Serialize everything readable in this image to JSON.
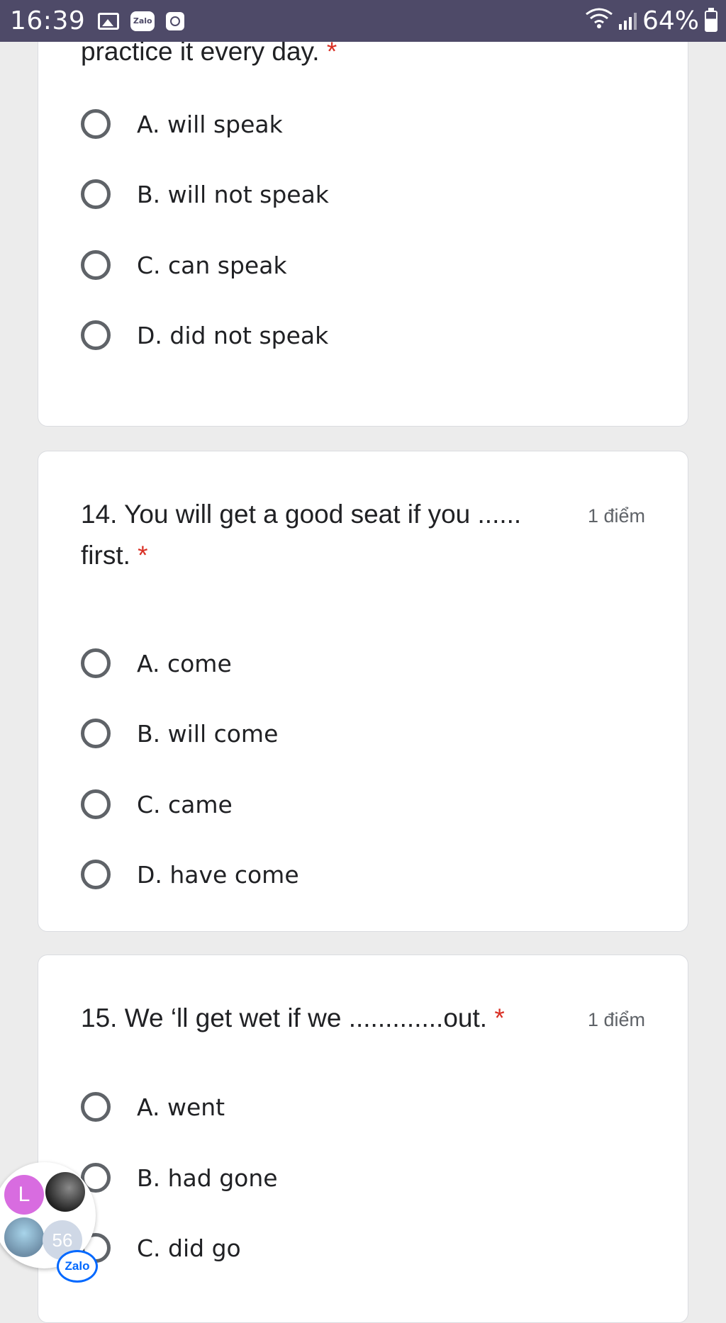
{
  "status_bar": {
    "time": "16:39",
    "zalo_icon_text": "Zalo",
    "battery_percent": "64%",
    "icons": [
      "gallery-icon",
      "zalo-icon",
      "clock-icon",
      "wifi-icon",
      "signal-icon",
      "battery-icon"
    ]
  },
  "questions": [
    {
      "title": "practice it every day.",
      "required_mark": "*",
      "options": [
        "A. will speak",
        "B. will not speak",
        "C. can speak",
        "D. did not speak"
      ]
    },
    {
      "title_line1": "14. You will get a good seat if you ......",
      "title_line2": "first.",
      "required_mark": "*",
      "points": "1 điểm",
      "options": [
        "A. come",
        "B. will come",
        "C. came",
        "D. have come"
      ]
    },
    {
      "title": "15. We ‘ll get wet if we .............out.",
      "required_mark": "*",
      "points": "1 điểm",
      "options": [
        "A. went",
        "B. had gone",
        "C. did go"
      ]
    }
  ],
  "chat_bubbles": {
    "avatar_letter": "L",
    "unread_count": "56",
    "app_badge": "Zalo"
  },
  "colors": {
    "status_bar": "#4e4a68",
    "background": "#ececec",
    "required": "#d93025",
    "radio": "#5f6368"
  }
}
